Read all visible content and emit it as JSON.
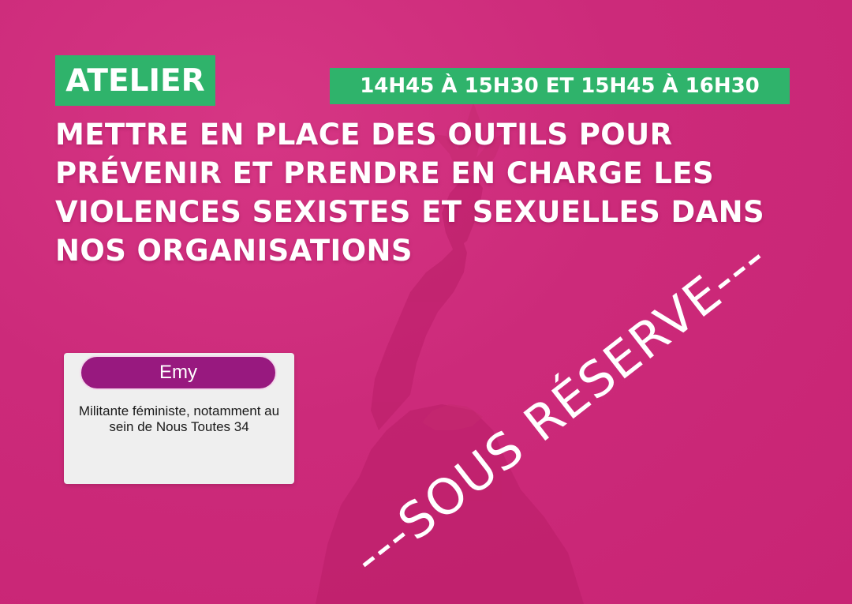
{
  "atelier_label": "ATELIER",
  "time_slot": "14H45 À 15H30 ET 15H45 À 16H30",
  "title_lines": [
    "METTRE EN PLACE DES OUTILS POUR",
    "PRÉVENIR ET PRENDRE EN CHARGE LES",
    "VIOLENCES SEXISTES ET SEXUELLES DANS",
    "NOS ORGANISATIONS"
  ],
  "speaker": {
    "name": "Emy",
    "description": "Militante féministe, notamment au sein de Nous Toutes 34"
  },
  "stamp_text": "---SOUS RÉSERVE---",
  "colors": {
    "background": "#cc2a7a",
    "tag_green": "#2fb36b",
    "name_purple": "#98197f",
    "card_background": "#efefef"
  }
}
